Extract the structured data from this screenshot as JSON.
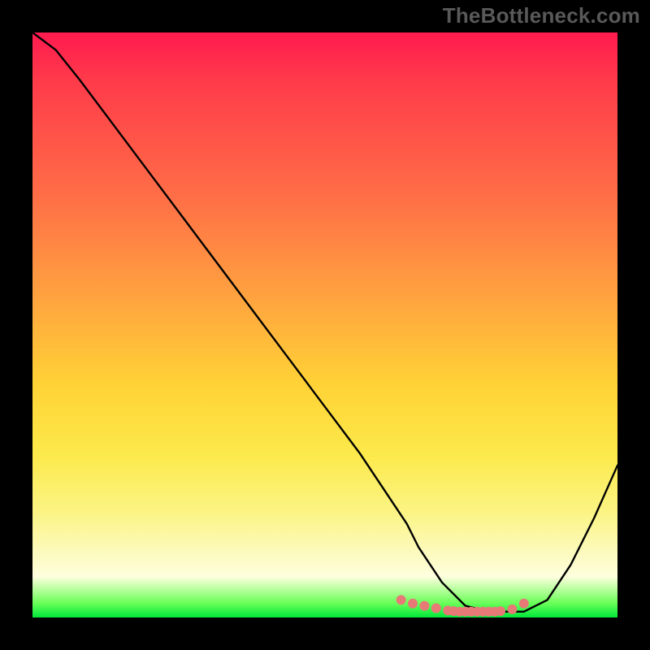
{
  "watermark": "TheBottleneck.com",
  "chart_data": {
    "type": "line",
    "title": "",
    "xlabel": "",
    "ylabel": "",
    "xlim": [
      0,
      100
    ],
    "ylim": [
      0,
      100
    ],
    "grid": false,
    "series": [
      {
        "name": "bottleneck-curve",
        "x": [
          0,
          4,
          8,
          14,
          20,
          26,
          32,
          38,
          44,
          50,
          56,
          62,
          64,
          66,
          70,
          74,
          78,
          82,
          84,
          88,
          92,
          96,
          100
        ],
        "y": [
          100,
          97,
          92,
          84,
          76,
          68,
          60,
          52,
          44,
          36,
          28,
          19,
          16,
          12,
          6,
          2,
          1,
          1,
          1,
          3,
          9,
          17,
          26
        ],
        "color": "#000000",
        "width": 2.4
      }
    ],
    "markers": {
      "name": "optimal-range",
      "x": [
        63,
        65,
        67,
        69,
        71,
        72,
        73,
        74,
        75,
        76,
        77,
        78,
        79,
        80,
        82,
        84
      ],
      "y": [
        3,
        2.4,
        2,
        1.6,
        1.2,
        1.1,
        1,
        1,
        1,
        1,
        1,
        1,
        1,
        1.1,
        1.4,
        2.4
      ],
      "color": "#e77a77",
      "size": 6
    }
  }
}
